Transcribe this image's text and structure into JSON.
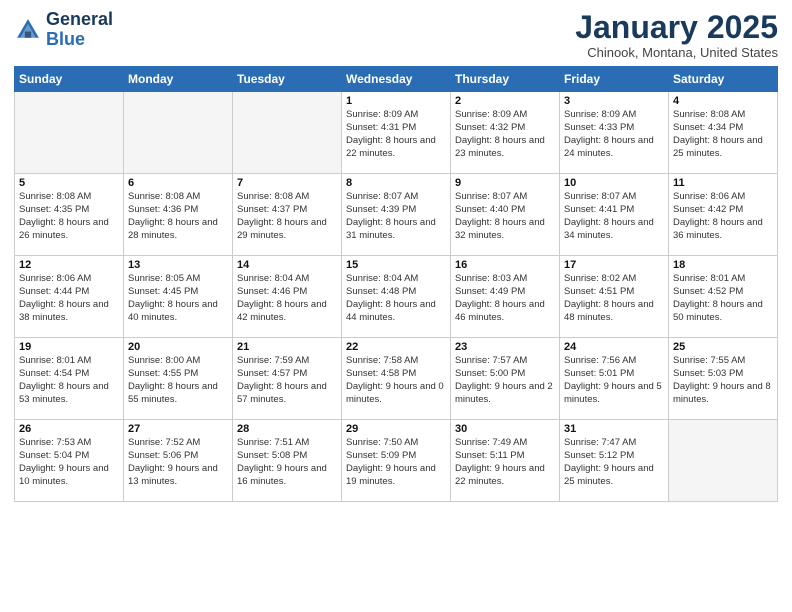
{
  "header": {
    "logo_general": "General",
    "logo_blue": "Blue",
    "month_title": "January 2025",
    "location": "Chinook, Montana, United States"
  },
  "days_of_week": [
    "Sunday",
    "Monday",
    "Tuesday",
    "Wednesday",
    "Thursday",
    "Friday",
    "Saturday"
  ],
  "weeks": [
    [
      {
        "num": "",
        "info": ""
      },
      {
        "num": "",
        "info": ""
      },
      {
        "num": "",
        "info": ""
      },
      {
        "num": "1",
        "info": "Sunrise: 8:09 AM\nSunset: 4:31 PM\nDaylight: 8 hours\nand 22 minutes."
      },
      {
        "num": "2",
        "info": "Sunrise: 8:09 AM\nSunset: 4:32 PM\nDaylight: 8 hours\nand 23 minutes."
      },
      {
        "num": "3",
        "info": "Sunrise: 8:09 AM\nSunset: 4:33 PM\nDaylight: 8 hours\nand 24 minutes."
      },
      {
        "num": "4",
        "info": "Sunrise: 8:08 AM\nSunset: 4:34 PM\nDaylight: 8 hours\nand 25 minutes."
      }
    ],
    [
      {
        "num": "5",
        "info": "Sunrise: 8:08 AM\nSunset: 4:35 PM\nDaylight: 8 hours\nand 26 minutes."
      },
      {
        "num": "6",
        "info": "Sunrise: 8:08 AM\nSunset: 4:36 PM\nDaylight: 8 hours\nand 28 minutes."
      },
      {
        "num": "7",
        "info": "Sunrise: 8:08 AM\nSunset: 4:37 PM\nDaylight: 8 hours\nand 29 minutes."
      },
      {
        "num": "8",
        "info": "Sunrise: 8:07 AM\nSunset: 4:39 PM\nDaylight: 8 hours\nand 31 minutes."
      },
      {
        "num": "9",
        "info": "Sunrise: 8:07 AM\nSunset: 4:40 PM\nDaylight: 8 hours\nand 32 minutes."
      },
      {
        "num": "10",
        "info": "Sunrise: 8:07 AM\nSunset: 4:41 PM\nDaylight: 8 hours\nand 34 minutes."
      },
      {
        "num": "11",
        "info": "Sunrise: 8:06 AM\nSunset: 4:42 PM\nDaylight: 8 hours\nand 36 minutes."
      }
    ],
    [
      {
        "num": "12",
        "info": "Sunrise: 8:06 AM\nSunset: 4:44 PM\nDaylight: 8 hours\nand 38 minutes."
      },
      {
        "num": "13",
        "info": "Sunrise: 8:05 AM\nSunset: 4:45 PM\nDaylight: 8 hours\nand 40 minutes."
      },
      {
        "num": "14",
        "info": "Sunrise: 8:04 AM\nSunset: 4:46 PM\nDaylight: 8 hours\nand 42 minutes."
      },
      {
        "num": "15",
        "info": "Sunrise: 8:04 AM\nSunset: 4:48 PM\nDaylight: 8 hours\nand 44 minutes."
      },
      {
        "num": "16",
        "info": "Sunrise: 8:03 AM\nSunset: 4:49 PM\nDaylight: 8 hours\nand 46 minutes."
      },
      {
        "num": "17",
        "info": "Sunrise: 8:02 AM\nSunset: 4:51 PM\nDaylight: 8 hours\nand 48 minutes."
      },
      {
        "num": "18",
        "info": "Sunrise: 8:01 AM\nSunset: 4:52 PM\nDaylight: 8 hours\nand 50 minutes."
      }
    ],
    [
      {
        "num": "19",
        "info": "Sunrise: 8:01 AM\nSunset: 4:54 PM\nDaylight: 8 hours\nand 53 minutes."
      },
      {
        "num": "20",
        "info": "Sunrise: 8:00 AM\nSunset: 4:55 PM\nDaylight: 8 hours\nand 55 minutes."
      },
      {
        "num": "21",
        "info": "Sunrise: 7:59 AM\nSunset: 4:57 PM\nDaylight: 8 hours\nand 57 minutes."
      },
      {
        "num": "22",
        "info": "Sunrise: 7:58 AM\nSunset: 4:58 PM\nDaylight: 9 hours\nand 0 minutes."
      },
      {
        "num": "23",
        "info": "Sunrise: 7:57 AM\nSunset: 5:00 PM\nDaylight: 9 hours\nand 2 minutes."
      },
      {
        "num": "24",
        "info": "Sunrise: 7:56 AM\nSunset: 5:01 PM\nDaylight: 9 hours\nand 5 minutes."
      },
      {
        "num": "25",
        "info": "Sunrise: 7:55 AM\nSunset: 5:03 PM\nDaylight: 9 hours\nand 8 minutes."
      }
    ],
    [
      {
        "num": "26",
        "info": "Sunrise: 7:53 AM\nSunset: 5:04 PM\nDaylight: 9 hours\nand 10 minutes."
      },
      {
        "num": "27",
        "info": "Sunrise: 7:52 AM\nSunset: 5:06 PM\nDaylight: 9 hours\nand 13 minutes."
      },
      {
        "num": "28",
        "info": "Sunrise: 7:51 AM\nSunset: 5:08 PM\nDaylight: 9 hours\nand 16 minutes."
      },
      {
        "num": "29",
        "info": "Sunrise: 7:50 AM\nSunset: 5:09 PM\nDaylight: 9 hours\nand 19 minutes."
      },
      {
        "num": "30",
        "info": "Sunrise: 7:49 AM\nSunset: 5:11 PM\nDaylight: 9 hours\nand 22 minutes."
      },
      {
        "num": "31",
        "info": "Sunrise: 7:47 AM\nSunset: 5:12 PM\nDaylight: 9 hours\nand 25 minutes."
      },
      {
        "num": "",
        "info": ""
      }
    ]
  ]
}
